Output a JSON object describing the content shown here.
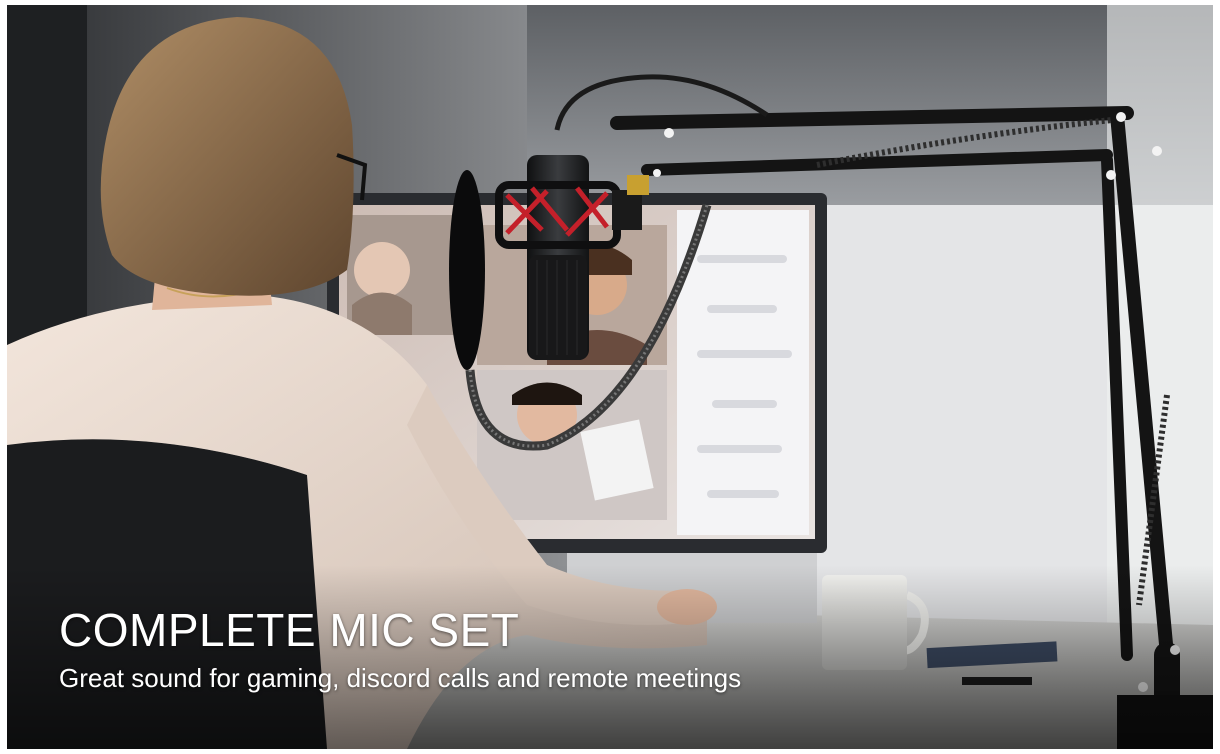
{
  "banner": {
    "headline": "COMPLETE MIC SET",
    "subline": "Great sound for gaming, discord calls and remote meetings",
    "text_color": "#ffffff"
  },
  "scene_colors": {
    "window_light": "#e9eaec",
    "wall_dark": "#3a3d40",
    "shirt": "#e8d9cf",
    "hair": "#8a6a48",
    "chair": "#1b1c1e",
    "mic_body": "#1f2022",
    "shock_mount_accent": "#c4202a",
    "arm_metal": "#141414",
    "monitor_bezel": "#2a2c30",
    "mug": "#f2f2ef"
  },
  "icons": [
    "pop-filter",
    "microphone",
    "shock-mount",
    "boom-arm",
    "monitor",
    "mug"
  ]
}
